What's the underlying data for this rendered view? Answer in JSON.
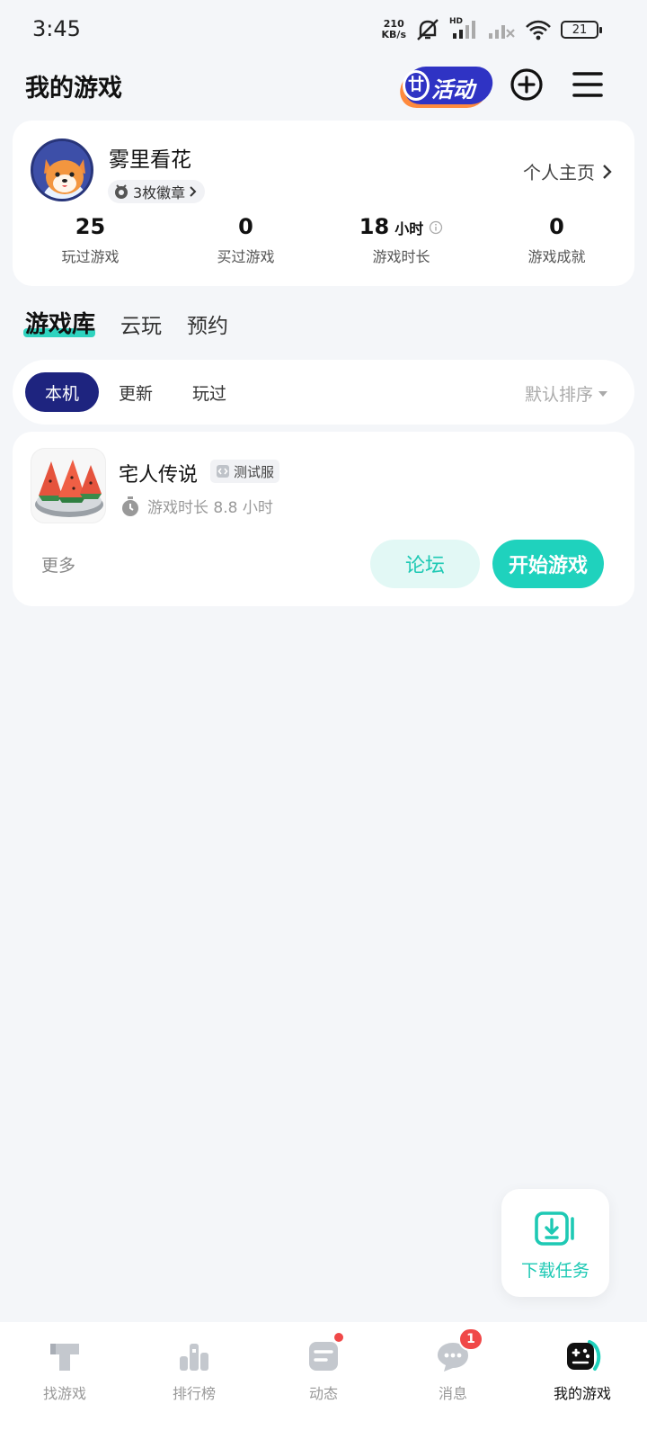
{
  "status_bar": {
    "time": "3:45",
    "net_speed_value": "210",
    "net_speed_unit": "KB/s",
    "hd_label": "HD",
    "battery": "21"
  },
  "header": {
    "title": "我的游戏",
    "activity_label": "活动",
    "activity_hat": "廿"
  },
  "profile": {
    "name": "雾里看花",
    "badge_text": "3枚徽章",
    "homepage_link": "个人主页",
    "stats": [
      {
        "value": "25",
        "unit": "",
        "label": "玩过游戏"
      },
      {
        "value": "0",
        "unit": "",
        "label": "买过游戏"
      },
      {
        "value": "18",
        "unit": "小时",
        "label": "游戏时长"
      },
      {
        "value": "0",
        "unit": "",
        "label": "游戏成就"
      }
    ]
  },
  "library_tabs": [
    "游戏库",
    "云玩",
    "预约"
  ],
  "filters": {
    "chips": [
      "本机",
      "更新",
      "玩过"
    ],
    "sort_label": "默认排序"
  },
  "game": {
    "name": "宅人传说",
    "tag": "测试服",
    "playtime": "游戏时长 8.8 小时",
    "more_label": "更多",
    "forum_label": "论坛",
    "start_label": "开始游戏"
  },
  "download_fab": {
    "label": "下载任务"
  },
  "bottom_nav": [
    {
      "label": "找游戏",
      "icon": "find-game-icon"
    },
    {
      "label": "排行榜",
      "icon": "ranking-icon"
    },
    {
      "label": "动态",
      "icon": "feed-icon"
    },
    {
      "label": "消息",
      "icon": "message-icon",
      "badge": "1"
    },
    {
      "label": "我的游戏",
      "icon": "my-games-icon"
    }
  ],
  "colors": {
    "accent": "#1fd2bd",
    "active_chip": "#1e247f",
    "notification": "#f04848",
    "background": "#f4f6f9"
  }
}
